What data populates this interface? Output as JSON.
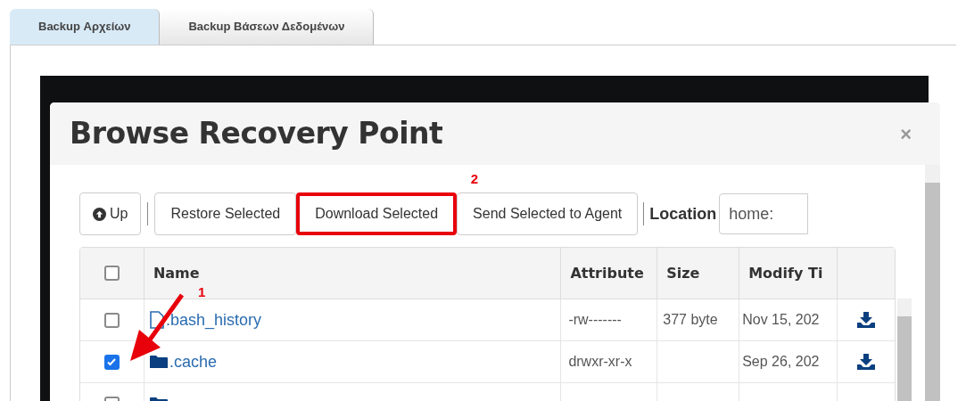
{
  "tabs": [
    {
      "label": "Backup Αρχείων",
      "selected": true
    },
    {
      "label": "Backup Βάσεων Δεδομένων",
      "selected": false
    }
  ],
  "dialog": {
    "title": "Browse Recovery Point",
    "close": "×",
    "toolbar": {
      "up": "Up",
      "buttons": [
        {
          "label": "Restore Selected",
          "highlighted": false
        },
        {
          "label": "Download Selected",
          "highlighted": true
        },
        {
          "label": "Send Selected to Agent",
          "highlighted": false
        }
      ],
      "location_label": "Location",
      "location_value": "home:"
    },
    "table": {
      "select_all_checked": false,
      "columns": [
        "Name",
        "Attribute",
        "Size",
        "Modify Ti"
      ],
      "rows": [
        {
          "kind": "file",
          "name": ".bash_history",
          "attributes": "-rw-------",
          "size": "377 byte",
          "modified": "Nov 15, 202",
          "checked": false
        },
        {
          "kind": "folder",
          "name": ".cache",
          "attributes": "drwxr-xr-x",
          "size": "",
          "modified": "Sep 26, 202",
          "checked": true
        },
        {
          "kind": "folder",
          "checked": false
        }
      ]
    }
  },
  "annotations": [
    {
      "label": "2"
    },
    {
      "label": "1"
    }
  ]
}
